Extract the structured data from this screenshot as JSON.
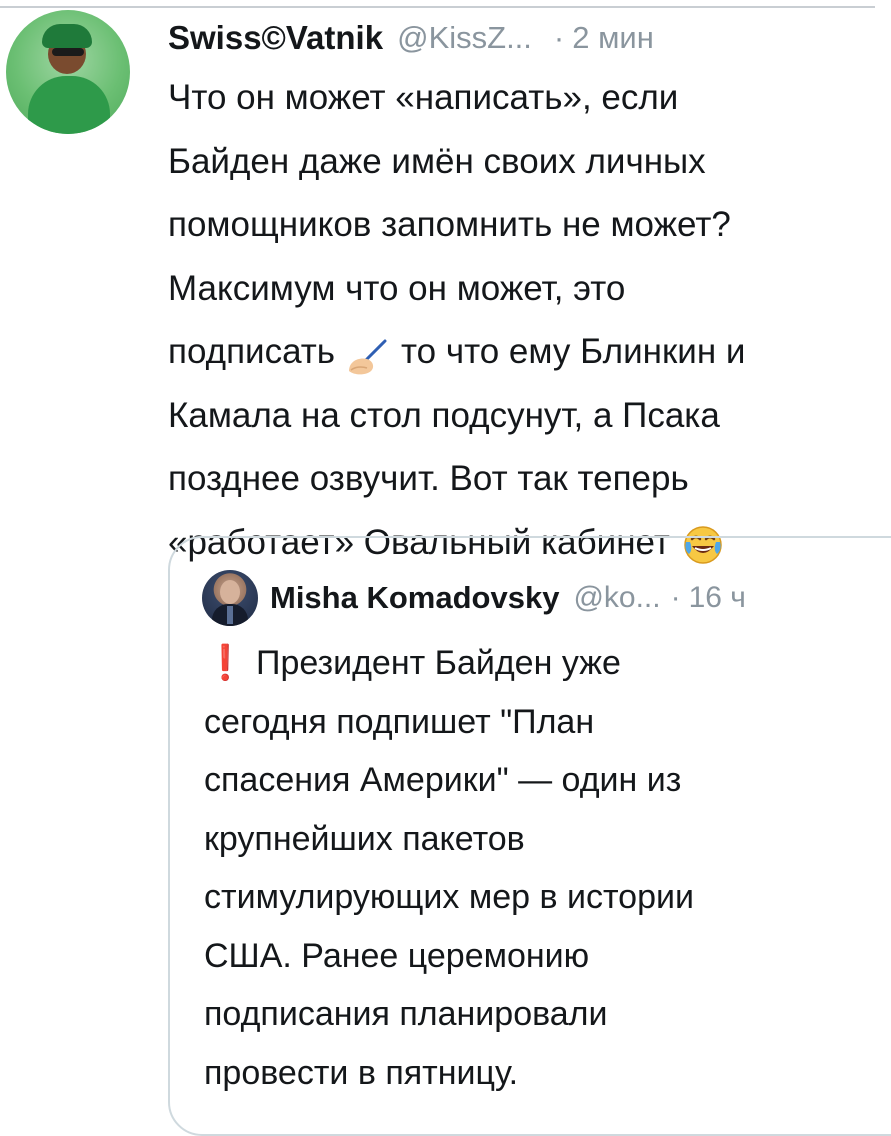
{
  "tweet": {
    "author": {
      "display_name": "Swiss©Vatnik",
      "handle": "@KissZ...",
      "avatar_icon": "user-avatar-green"
    },
    "separator": "·",
    "time": "2 мин",
    "text_lines": [
      "Что он может «написать», если",
      "Байден даже имён своих личных",
      "помощников запомнить не может?",
      "Максимум что он может, это",
      "подписать",
      "то что ему Блинкин и",
      "Камала на стол подсунут, а Псака",
      "позднее озвучит. Вот так теперь",
      "«работает» Овальный кабинет"
    ],
    "emojis": [
      "writing-hand-icon",
      "tears-of-joy-icon"
    ]
  },
  "quoted_tweet": {
    "author": {
      "display_name": "Misha Komadovsky",
      "handle": "@ko...",
      "avatar_icon": "user-avatar-photo"
    },
    "separator": "·",
    "time": "16 ч",
    "exclamation": "❗",
    "text_lines": [
      "Президент Байден уже",
      "сегодня подпишет \"План",
      "спасения Америки\" — один из",
      "крупнейших пакетов",
      "стимулирующих мер в истории",
      "США. Ранее церемонию",
      "подписания планировали",
      "провести в пятницу."
    ]
  },
  "colors": {
    "text": "#14171a",
    "secondary": "#8a959e",
    "border": "#cfd9de",
    "exclamation": "#d61f2b"
  }
}
